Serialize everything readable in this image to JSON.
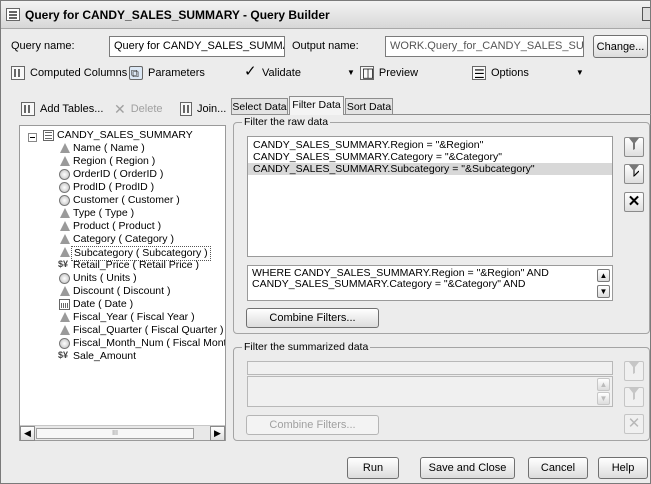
{
  "window": {
    "title": "Query for CANDY_SALES_SUMMARY - Query Builder"
  },
  "header": {
    "query_name_label": "Query name:",
    "query_name_value": "Query for CANDY_SALES_SUMMARY",
    "output_name_label": "Output name:",
    "output_name_value": "WORK.Query_for_CANDY_SALES_SUMMAF",
    "change_button": "Change..."
  },
  "toolbar": {
    "computed_columns": "Computed Columns",
    "parameters": "Parameters",
    "validate": "Validate",
    "preview": "Preview",
    "options": "Options"
  },
  "left_toolbar": {
    "add_tables": "Add Tables...",
    "delete": "Delete",
    "join": "Join..."
  },
  "tree": {
    "root": "CANDY_SALES_SUMMARY",
    "items": [
      {
        "label": "Name ( Name )",
        "icon": "char"
      },
      {
        "label": "Region ( Region )",
        "icon": "char"
      },
      {
        "label": "OrderID ( OrderID )",
        "icon": "numeric"
      },
      {
        "label": "ProdID ( ProdID )",
        "icon": "numeric"
      },
      {
        "label": "Customer ( Customer )",
        "icon": "numeric"
      },
      {
        "label": "Type ( Type )",
        "icon": "char"
      },
      {
        "label": "Product ( Product )",
        "icon": "char"
      },
      {
        "label": "Category ( Category )",
        "icon": "char"
      },
      {
        "label": "Subcategory ( Subcategory )",
        "icon": "char",
        "selected": true
      },
      {
        "label": "Retail_Price ( Retail Price )",
        "icon": "currency"
      },
      {
        "label": "Units ( Units )",
        "icon": "numeric"
      },
      {
        "label": "Discount ( Discount )",
        "icon": "char"
      },
      {
        "label": "Date ( Date )",
        "icon": "date"
      },
      {
        "label": "Fiscal_Year ( Fiscal Year )",
        "icon": "char"
      },
      {
        "label": "Fiscal_Quarter ( Fiscal Quarter )",
        "icon": "char"
      },
      {
        "label": "Fiscal_Month_Num ( Fiscal Month N",
        "icon": "numeric"
      },
      {
        "label": "Sale_Amount",
        "icon": "currency"
      }
    ],
    "scrollbar_thumb": "III"
  },
  "tabs": {
    "select_data": "Select Data",
    "filter_data": "Filter Data",
    "sort_data": "Sort Data"
  },
  "filter_raw": {
    "group_title": "Filter the raw data",
    "filters": [
      "CANDY_SALES_SUMMARY.Region = \"&Region\"",
      "CANDY_SALES_SUMMARY.Category = \"&Category\"",
      "CANDY_SALES_SUMMARY.Subcategory = \"&Subcategory\""
    ],
    "where_text": "WHERE CANDY_SALES_SUMMARY.Region = \"&Region\" AND CANDY_SALES_SUMMARY.Category = \"&Category\" AND",
    "combine_button": "Combine Filters..."
  },
  "filter_summarized": {
    "group_title": "Filter the summarized data",
    "combine_button": "Combine Filters..."
  },
  "footer": {
    "run": "Run",
    "save_and_close": "Save and Close",
    "cancel": "Cancel",
    "help": "Help"
  }
}
